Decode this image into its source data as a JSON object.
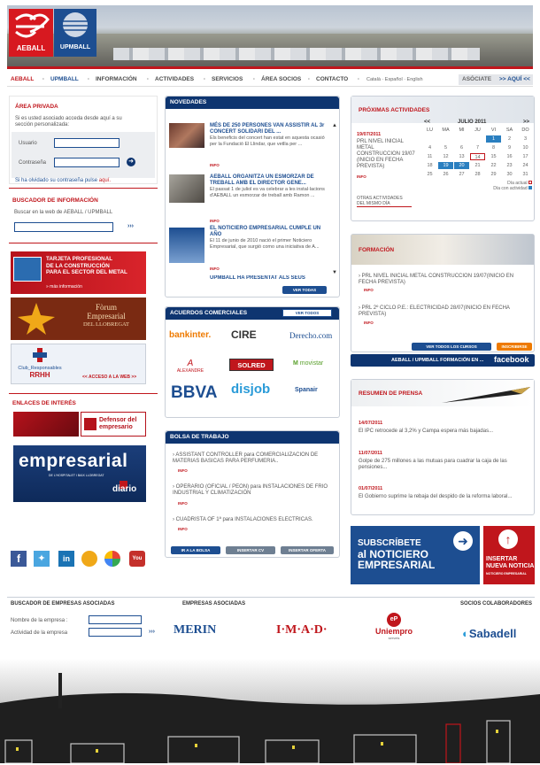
{
  "logos": {
    "aeball": "AEBALL",
    "upmball": "UPMBALL"
  },
  "nav": {
    "items": [
      "AEBALL",
      "UPMBALL",
      "INFORMACIÓN",
      "ACTIVIDADES",
      "SERVICIOS",
      "ÁREA SOCIOS",
      "CONTACTO"
    ],
    "separator": "·",
    "lang": "Català · Español · English",
    "asociate": "ASÓCIATE",
    "aqui": ">> AQUÍ <<"
  },
  "area_privada": {
    "title": "ÁREA PRIVADA",
    "intro": "Si es usted asociado acceda desde aquí a su sección personalizada:",
    "user_label": "Usuario",
    "pass_label": "Contraseña",
    "forgot_prefix": "Si ha olvidado su contraseña pulse ",
    "forgot_link": "aquí."
  },
  "buscador": {
    "title": "BUSCADOR DE INFORMACIÓN",
    "intro": "Buscar en la web de AEBALL / UPMBALL",
    "go": "›››"
  },
  "banners": {
    "tarjeta": [
      "TARJETA PROFESIONAL",
      "DE LA CONSTRUCCIÓN",
      "PARA EL SECTOR DEL METAL"
    ],
    "tarjeta_more": "» más información",
    "forum": [
      "Fòrum",
      "Empresarial",
      "DEL LLOBREGAT"
    ],
    "club": [
      "Club_Responsables",
      "RRHH"
    ],
    "club_link": "<< ACCESO A LA WEB >>"
  },
  "enlaces": {
    "title": "ENLACES DE INTERÉS",
    "defensor": [
      "Defensor del",
      "empresario"
    ],
    "empresarial": "empresarial",
    "diario": "diario",
    "empresarial_sub": "DE L'HOSPITALET I BAIX LLOBREGAT"
  },
  "novedades": {
    "title": "NOVEDADES",
    "items": [
      {
        "title": "MÉS DE 250 PERSONES VAN ASSISTIR AL 3r CONCERT SOLIDARI DEL ...",
        "body": "Els beneficis del concert han estat en aquesta ocasió per la Fundació El Llindar, que vetlla per ..."
      },
      {
        "title": "AEBALL ORGANITZA UN ESMORZAR DE TREBALL AMB EL DIRECTOR GENE...",
        "body": "El passat 1 de juliol es va celebrar a les instal·lacions d'AEBALL un esmorzar de treball amb Ramon ..."
      },
      {
        "title": "EL NOTICIERO EMPRESARIAL CUMPLE UN AÑO",
        "body": "El 11 de junio de 2010 nació el primer Noticiero Empresarial, que surgió como una iniciativa de A..."
      },
      {
        "title": "UPMBALL HA PRESENTAT ALS SEUS",
        "body": ""
      }
    ],
    "info": "INFO",
    "ver_todas": "VER TODAS"
  },
  "acuerdos": {
    "title": "ACUERDOS COMERCIALES",
    "ver_todos": "VER TODOS",
    "logos": [
      "bankinter.",
      "CIRE",
      "Derecho.com",
      "ALEXANDRE",
      "SOLRED",
      "movistar",
      "BBVA",
      "disjob",
      "Spanair"
    ]
  },
  "bolsa": {
    "title": "BOLSA DE TRABAJO",
    "items": [
      "ASSISTANT CONTROLLER para COMERCIALIZACION DE MATERIAS BASICAS PARA PERFUMERIA..",
      "OPERARIO (OFICIAL / PEON) para INSTALACIONES DE FRIO INDUSTRIAL Y CLIMATIZACIÓN",
      "CUADRISTA OF 1ª para INSTALACIONES ELECTRICAS."
    ],
    "info": "INFO",
    "buttons": [
      "IR A LA BOLSA",
      "INSERTAR CV",
      "INSERTAR OFERTA"
    ]
  },
  "proximas": {
    "title": "PRÓXIMAS ACTIVIDADES",
    "date": "19/07/2011",
    "event": "PRL NIVEL INICIAL METAL CONSTRUCCION 19/07 (INICIO EN FECHA PREVISTA)",
    "info": "INFO",
    "otras": "OTRAS ACTIVIDADES DEL MISMO DÍA",
    "calendar": {
      "prev": "<<",
      "next": ">>",
      "month": "JULIO 2011",
      "days": [
        "LU",
        "MA",
        "MI",
        "JU",
        "VI",
        "SA",
        "DO"
      ],
      "rows": [
        [
          "",
          "",
          "",
          "",
          "1",
          "2",
          "3"
        ],
        [
          "4",
          "5",
          "6",
          "7",
          "8",
          "9",
          "10"
        ],
        [
          "11",
          "12",
          "13",
          "14",
          "15",
          "16",
          "17"
        ],
        [
          "18",
          "19",
          "20",
          "21",
          "22",
          "23",
          "24"
        ],
        [
          "25",
          "26",
          "27",
          "28",
          "29",
          "30",
          "31"
        ]
      ],
      "legend_actual": "Día actual",
      "legend_act": "Día con actividad"
    }
  },
  "formacion": {
    "title": "FORMACIÓN",
    "items": [
      "PRL NIVEL INICIAL METAL CONSTRUCCION 19/07(INICIO EN FECHA PREVISTA)",
      "PRL 2º CICLO P.E.: ELECTRICIDAD 28/07(INICIO EN FECHA PREVISTA)"
    ],
    "info": "INFO",
    "ver_cursos": "VER TODOS LOS CURSOS",
    "inscribirse": "INSCRIBIRSE",
    "facebook_prefix": "AEBALL / UPMBALL FORMACIÓN EN ...",
    "facebook": "facebook"
  },
  "prensa": {
    "title": "RESUMEN DE PRENSA",
    "items": [
      {
        "date": "14/07/2011",
        "text": "El IPC retrocede al 3,2% y Campa espera más bajadas..."
      },
      {
        "date": "11/07/2011",
        "text": "Golpe de 275 millones a las mutuas para cuadrar la caja de las pensiones..."
      },
      {
        "date": "01/07/2011",
        "text": "El Gobierno suprime la rebaja del despido de la reforma laboral..."
      }
    ]
  },
  "subscribe": {
    "lines": [
      "SUBSCRÍBETE",
      "al NOTICIERO",
      "EMPRESARIAL"
    ]
  },
  "insertar": {
    "lines": [
      "INSERTAR",
      "NUEVA NOTICIA"
    ],
    "sub": "NOTICIERO EMPRESARIAL"
  },
  "footer": {
    "buscador_title": "BUSCADOR DE EMPRESAS ASOCIADAS",
    "empresas_title": "EMPRESAS ASOCIADAS",
    "socios_title": "SOCIOS COLABORADORES",
    "nombre_label": "Nombre de la empresa :",
    "actividad_label": "Actividad de la empresa",
    "go": "›››",
    "logos": [
      "MERIN",
      "I·M·A·D·",
      "Uniempro",
      "Sabadell"
    ],
    "uniempro_sub": "serveis"
  },
  "colors": {
    "red": "#c0161c",
    "blue": "#1d4e91",
    "navy": "#0e3570"
  }
}
